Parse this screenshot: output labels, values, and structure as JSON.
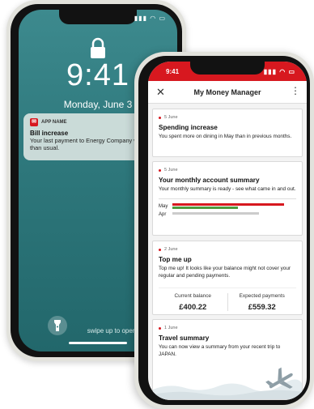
{
  "lock_screen": {
    "time": "9:41",
    "date": "Monday, June 3",
    "notification": {
      "app_name": "APP NAME",
      "title": "Bill increase",
      "body": "Your last payment to Energy Company was higher than usual."
    },
    "swipe_hint": "swipe up to open",
    "icons": [
      "signal-icon",
      "wifi-icon",
      "battery-icon",
      "lock-icon",
      "flashlight-icon"
    ]
  },
  "app": {
    "status_time": "9:41",
    "header": {
      "title": "My Money Manager",
      "close_icon": "close-icon",
      "menu_icon": "more-vertical-icon"
    },
    "accent_color": "#d7181f",
    "cards": [
      {
        "date": "5 June",
        "title": "Spending increase",
        "text": "You spent more on dining in May than in previous months."
      },
      {
        "date": "5 June",
        "title": "Your monthly account summary",
        "text": "Your monthly summary is ready - see what came in and out.",
        "rows": [
          {
            "label": "May",
            "in_fraction": 0.9,
            "out_fraction": 0.53
          },
          {
            "label": "Apr",
            "in_fraction": 0.7,
            "out_fraction": 0.0
          }
        ],
        "colors": {
          "in": "#d7181f",
          "out": "#4e9a3f",
          "prev": "#cccccc"
        }
      },
      {
        "date": "2 June",
        "title": "Top me up",
        "text": "Top me up! It looks like your balance might not cover your regular and pending payments.",
        "current_label": "Current balance",
        "current_value": "£400.22",
        "expected_label": "Expected payments",
        "expected_value": "£559.32"
      },
      {
        "date": "1 June",
        "title": "Travel summary",
        "text": "You can now view a summary from your recent trip to JAPAN."
      }
    ]
  }
}
